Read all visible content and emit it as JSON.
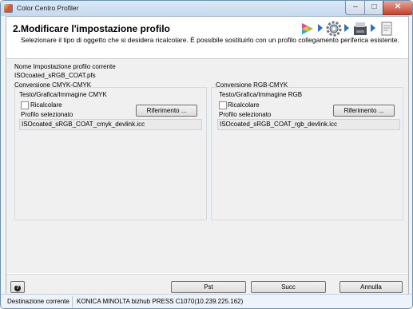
{
  "window": {
    "title": "Color Centro Profiler",
    "controls": {
      "minimize": "–",
      "maximize": "□",
      "close": "✕"
    }
  },
  "header": {
    "title": "2.Modificare l'impostazione profilo",
    "description": "Selezionare il tipo di oggetto che si desidera ricalcolare. È possibile sostituirlo con un profilo collegamento periferica esistente.",
    "wizard_icons": [
      "colors-icon",
      "gear-icon",
      "printer-icon",
      "document-icon"
    ]
  },
  "current_profile": {
    "label": "Nome Impostazione profilo corrente",
    "value": "ISOcoated_sRGB_COAT.pfs"
  },
  "cmyk_group": {
    "title": "Conversione CMYK-CMYK",
    "subtitle": "Testo/Grafica/Immagine CMYK",
    "recalc_label": "Ricalcolare",
    "recalc_checked": false,
    "reference_button": "Riferimento ...",
    "selected_profile_label": "Profilo selezionato",
    "selected_profile_value": "ISOcoated_sRGB_COAT_cmyk_devlink.icc"
  },
  "rgb_group": {
    "title": "Conversione RGB-CMYK",
    "subtitle": "Testo/Grafica/Immagine RGB",
    "recalc_label": "Ricalcolare",
    "recalc_checked": false,
    "reference_button": "Riferimento ...",
    "selected_profile_label": "Profilo selezionato",
    "selected_profile_value": "ISOcoated_sRGB_COAT_rgb_devlink.icc"
  },
  "footer": {
    "help": "?",
    "prev": "Pst",
    "next": "Succ",
    "cancel": "Annulla"
  },
  "status": {
    "label": "Destinazione corrente",
    "value": "KONICA MINOLTA bizhub PRESS C1070(10.239.225.162)"
  }
}
